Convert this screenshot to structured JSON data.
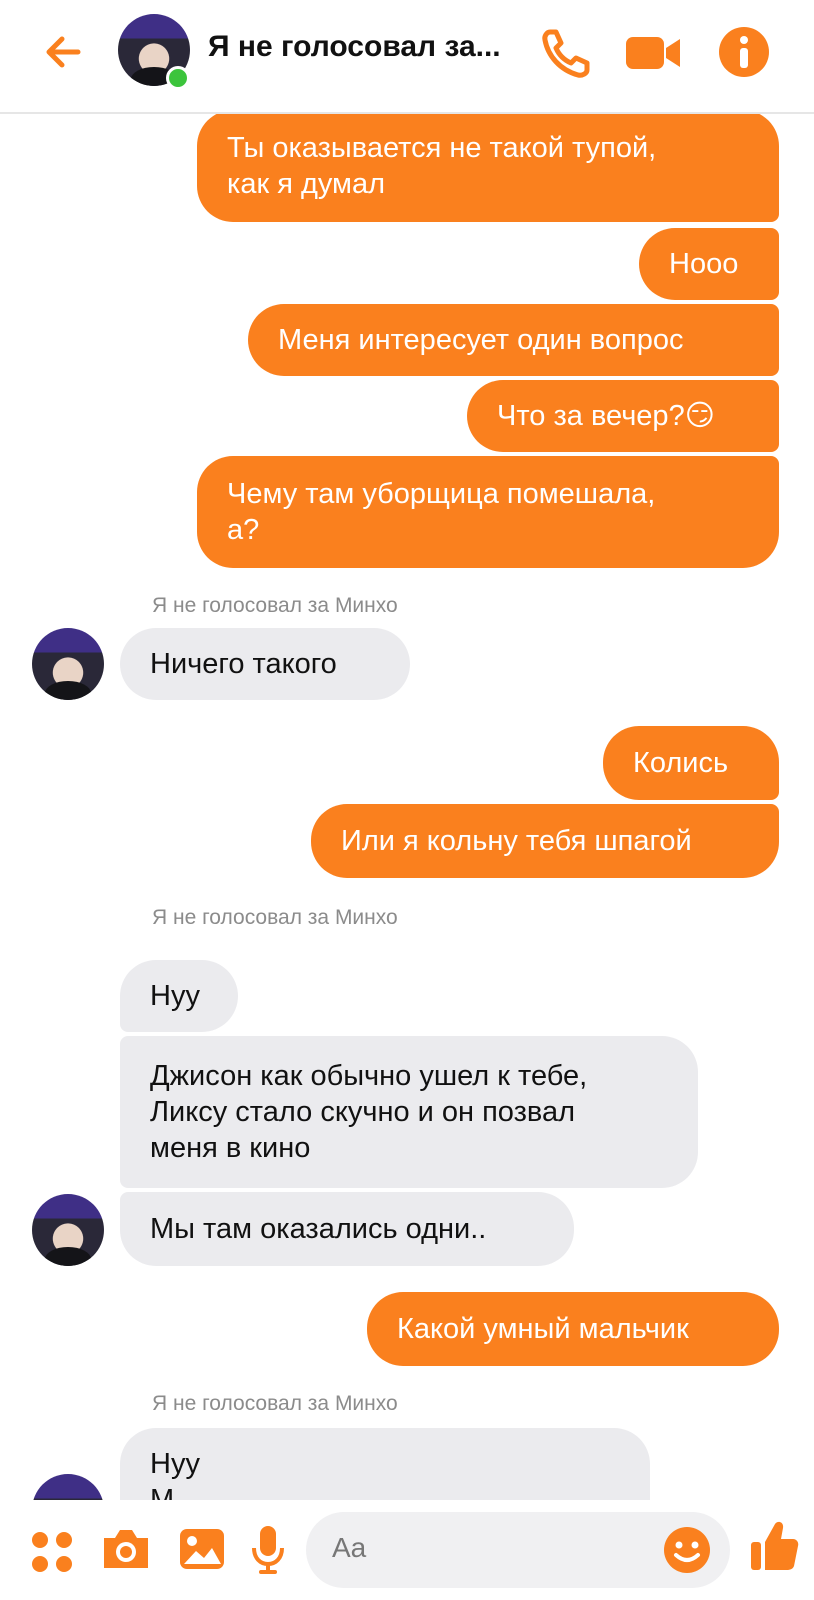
{
  "header": {
    "title": "Я не голосовал за...",
    "back_icon": "arrow-left-icon",
    "call_icon": "phone-icon",
    "video_icon": "video-camera-icon",
    "info_icon": "info-icon",
    "online": true
  },
  "theme": {
    "accent": "#fa801e",
    "incoming_bg": "#ebebee",
    "online_dot": "#3cc43c"
  },
  "messages": [
    {
      "text": "Ты оказывается не такой тупой,\nкак я думал",
      "dir": "out"
    },
    {
      "text": "Нооо",
      "dir": "out"
    },
    {
      "text": "Меня интересует один вопрос",
      "dir": "out"
    },
    {
      "text": "Что за вечер?😏",
      "dir": "out"
    },
    {
      "text": "Чему там уборщица помешала,\nа?",
      "dir": "out"
    },
    {
      "text": "Я не голосовал за Минхо",
      "kind": "sender"
    },
    {
      "text": "Ничего такого",
      "dir": "in"
    },
    {
      "text": "Колись",
      "dir": "out"
    },
    {
      "text": "Или я кольну тебя шпагой",
      "dir": "out"
    },
    {
      "text": "Я не голосовал за Минхо",
      "kind": "sender"
    },
    {
      "text": "Нуу",
      "dir": "in"
    },
    {
      "text": "Джисон как обычно ушел к тебе,\nЛиксу стало скучно и он позвал\nменя в кино",
      "dir": "in"
    },
    {
      "text": "Мы там оказались одни..",
      "dir": "in"
    },
    {
      "text": "Какой умный мальчик",
      "dir": "out"
    },
    {
      "text": "Я не голосовал за Минхо",
      "kind": "sender"
    },
    {
      "text": "Нуу\nМ",
      "dir": "in"
    }
  ],
  "composer": {
    "placeholder": "Aa",
    "icons": [
      "grid-menu-icon",
      "camera-icon",
      "image-icon",
      "microphone-icon",
      "emoji-icon",
      "thumbs-up-icon"
    ]
  }
}
